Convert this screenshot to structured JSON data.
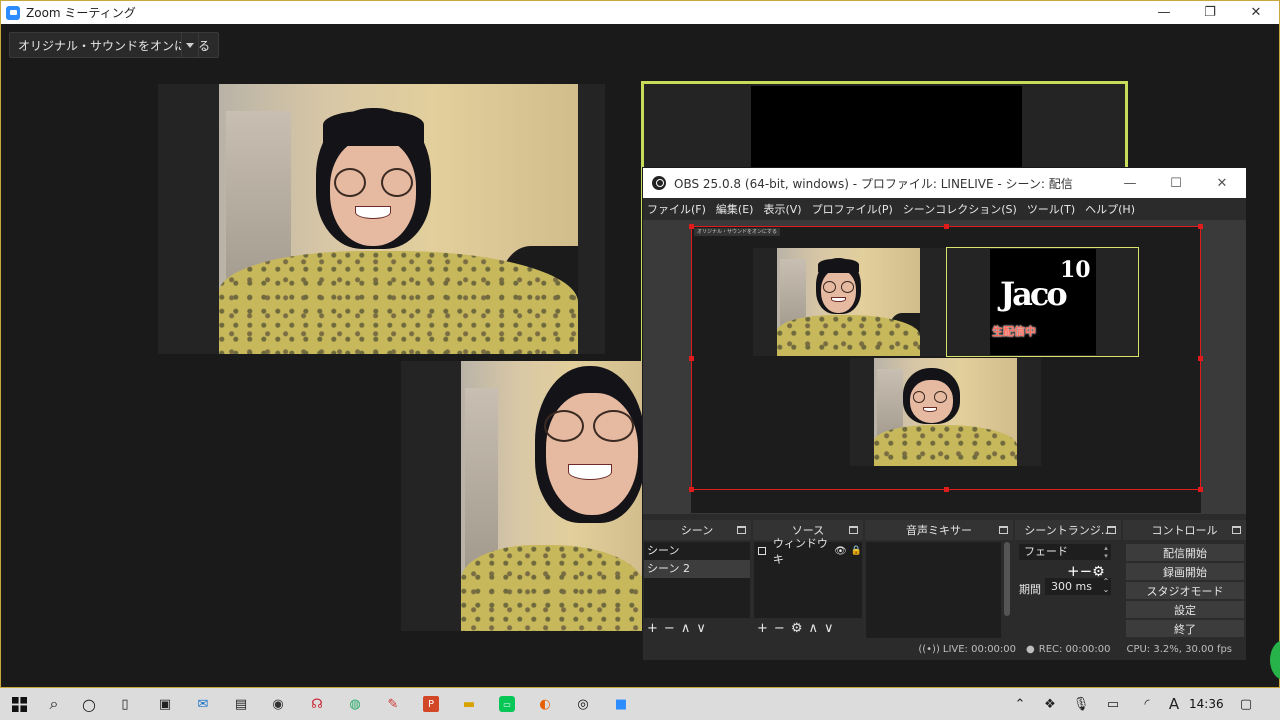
{
  "zoom": {
    "title": "Zoom ミーティング",
    "sound_button": "オリジナル・サウンドをオンにする"
  },
  "obs": {
    "title": "OBS 25.0.8 (64-bit, windows) - プロファイル: LINELIVE - シーン: 配信",
    "menu": [
      "ファイル(F)",
      "編集(E)",
      "表示(V)",
      "プロファイル(P)",
      "シーンコレクション(S)",
      "ツール(T)",
      "ヘルプ(H)"
    ],
    "preview": {
      "mini_sound_label": "オリジナル・サウンドをオンにする",
      "logo_text": "Jaco",
      "logo_number": "10",
      "live_label": "生配信中"
    },
    "docks": {
      "scenes": {
        "title": "シーン",
        "items": [
          "シーン",
          "シーン 2"
        ]
      },
      "sources": {
        "title": "ソース",
        "items": [
          "ウィンドウキ"
        ]
      },
      "mixer": {
        "title": "音声ミキサー"
      },
      "transitions": {
        "title": "シーントランジ…",
        "selected": "フェード",
        "duration_label": "期間",
        "duration_value": "300 ms"
      },
      "controls": {
        "title": "コントロール",
        "buttons": [
          "配信開始",
          "録画開始",
          "スタジオモード",
          "設定",
          "終了"
        ]
      }
    },
    "status": {
      "live": "LIVE: 00:00:00",
      "rec": "REC: 00:00:00",
      "cpu": "CPU: 3.2%, 30.00 fps"
    }
  },
  "taskbar": {
    "clock": "14:36",
    "ime": "A"
  }
}
